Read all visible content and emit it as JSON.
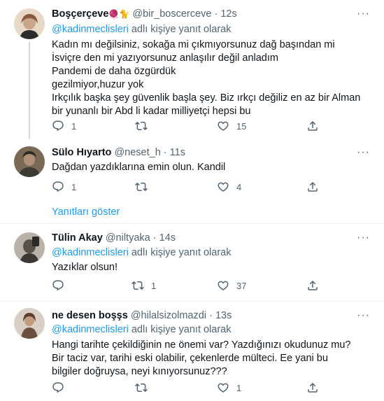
{
  "tweets": [
    {
      "name": "Boşçerçeve",
      "name_emoji": "🧶🐈",
      "handle": "@bir_boscerceve",
      "separator": "·",
      "time": "12s",
      "more": "···",
      "reply_to_mention": "@kadinmeclisleri",
      "reply_to_suffix": " adlı kişiye yanıt olarak",
      "lines": [
        "Kadın mı değilsiniz, sokağa mi çıkmıyorsunuz dağ başından mi İsviçre den mi yazıyorsunuz anlaşılır değil anladım",
        "Pandemi de daha özgürdük",
        "gezilmiyor,huzur yok",
        "Irkçılık başka şey güvenlik başla şey. Biz ırkçı değiliz en az bir Alman bir yunanlı bir Abd li kadar milliyetçi hepsi bu"
      ],
      "replies": "1",
      "retweets": "",
      "likes": "15",
      "avatar_colors": [
        "#e8d9c7",
        "#8a5a3c"
      ]
    },
    {
      "name": "Sülo Hıyarto",
      "handle": "@neset_h",
      "separator": "·",
      "time": "11s",
      "more": "···",
      "lines": [
        "Dağdan yazdıklarına emin olun. Kandil"
      ],
      "replies": "1",
      "retweets": "",
      "likes": "4",
      "show_replies": "Yanıtları göster",
      "avatar_colors": [
        "#7a6a55",
        "#2e2a25"
      ]
    },
    {
      "name": "Tülin Akay",
      "handle": "@niltyaka",
      "separator": "·",
      "time": "14s",
      "more": "···",
      "reply_to_mention": "@kadinmeclisleri",
      "reply_to_suffix": " adlı kişiye yanıt olarak",
      "lines": [
        "Yazıklar olsun!"
      ],
      "replies": "",
      "retweets": "1",
      "likes": "37",
      "avatar_colors": [
        "#b8b2a8",
        "#3b3834"
      ]
    },
    {
      "name": "ne desen boşşs",
      "handle": "@hilalsizolmazdi",
      "separator": "·",
      "time": "13s",
      "more": "···",
      "reply_to_mention": "@kadinmeclisleri",
      "reply_to_suffix": " adlı kişiye yanıt olarak",
      "lines": [
        "Hangi tarihte çekildiğinin ne önemi var? Yazdığınızı okudunuz mu? Bir taciz var, tarihi eski olabilir, çekenlerde mülteci. Ee yani bu bilgiler doğruysa, neyi kınıyorsunuz???"
      ],
      "replies": "",
      "retweets": "",
      "likes": "1",
      "avatar_colors": [
        "#d9cfc4",
        "#5a3e2e"
      ]
    }
  ],
  "icons": {
    "reply": "reply-icon",
    "retweet": "retweet-icon",
    "like": "heart-icon",
    "share": "share-icon",
    "more": "more-icon"
  },
  "colors": {
    "accent": "#1d9bf0",
    "secondary_text": "#536471",
    "divider": "#eff3f4"
  }
}
